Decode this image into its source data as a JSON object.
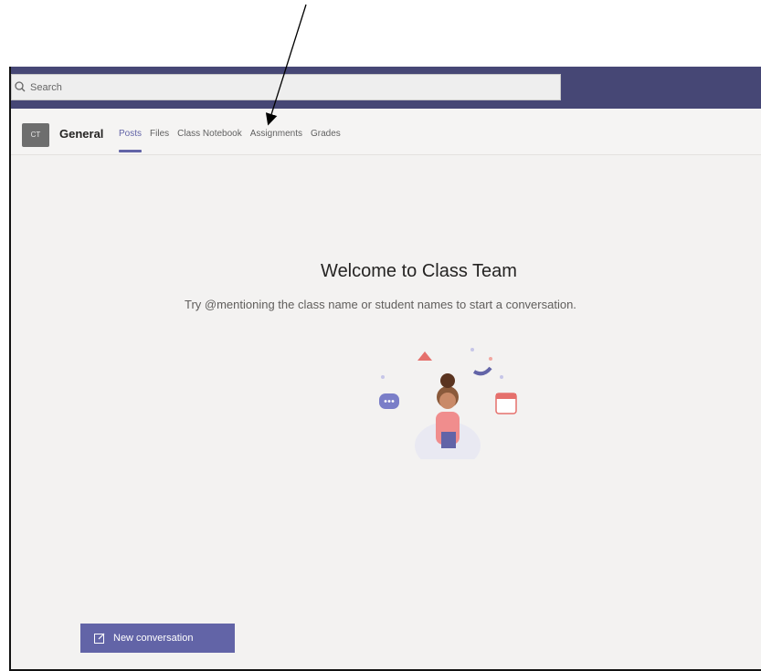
{
  "search": {
    "placeholder": "Search"
  },
  "channel": {
    "avatar_text": "CT",
    "name": "General",
    "tabs": [
      {
        "label": "Posts",
        "active": true
      },
      {
        "label": "Files",
        "active": false
      },
      {
        "label": "Class Notebook",
        "active": false
      },
      {
        "label": "Assignments",
        "active": false
      },
      {
        "label": "Grades",
        "active": false
      }
    ]
  },
  "welcome": {
    "title": "Welcome to Class Team",
    "subtitle": "Try @mentioning the class name or student names to start a conversation."
  },
  "compose": {
    "new_conversation_label": "New conversation"
  },
  "colors": {
    "brand": "#464775",
    "accent": "#6264a7",
    "background": "#f3f2f1"
  },
  "icons": {
    "search": "search-icon",
    "compose": "compose-icon",
    "annotation": "arrow-pointer-icon"
  }
}
